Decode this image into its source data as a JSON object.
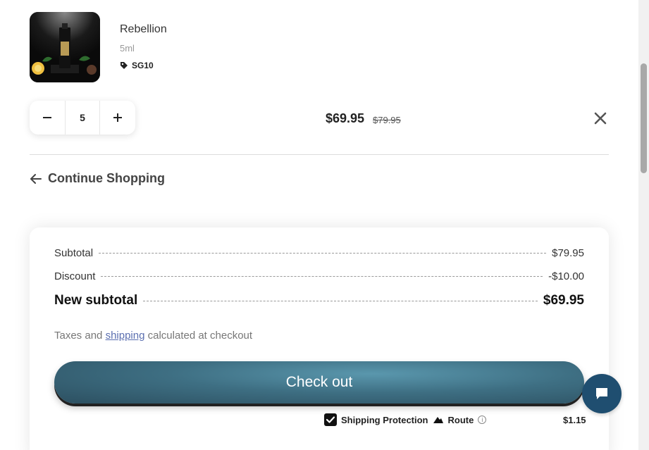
{
  "product": {
    "name": "Rebellion",
    "variant": "5ml",
    "discount_code": "SG10",
    "quantity": "5",
    "price": "$69.95",
    "compare_price": "$79.95",
    "icons": {
      "decrease": "minus-icon",
      "increase": "plus-icon",
      "remove": "close-icon",
      "tag": "tag-icon"
    }
  },
  "nav": {
    "continue_label": "Continue Shopping",
    "icon": "arrow-left-icon"
  },
  "summary": {
    "subtotal_label": "Subtotal",
    "subtotal_value": "$79.95",
    "discount_label": "Discount",
    "discount_value": "-$10.00",
    "new_subtotal_label": "New subtotal",
    "new_subtotal_value": "$69.95",
    "taxes_prefix": "Taxes and",
    "taxes_link": "shipping",
    "taxes_suffix": "calculated at checkout",
    "checkout_label": "Check out",
    "protection_label": "Shipping Protection",
    "protection_brand": "Route",
    "protection_price": "$1.15",
    "protection_checked": true
  },
  "colors": {
    "checkout_button": "#3e6f83",
    "chat_button": "#1f4e70",
    "link": "#5b6fb0"
  }
}
